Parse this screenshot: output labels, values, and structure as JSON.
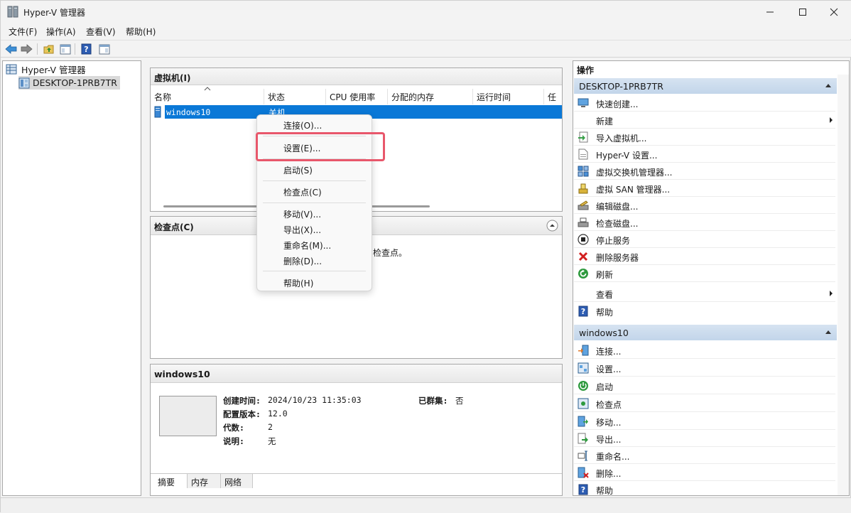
{
  "window": {
    "title": "Hyper-V 管理器"
  },
  "menubar": {
    "items": [
      "文件(F)",
      "操作(A)",
      "查看(V)",
      "帮助(H)"
    ]
  },
  "tree": {
    "root": "Hyper-V 管理器",
    "child": "DESKTOP-1PRB7TR"
  },
  "vm_panel": {
    "title": "虚拟机(I)",
    "columns": [
      "名称",
      "状态",
      "CPU 使用率",
      "分配的内存",
      "运行时间",
      "任务"
    ],
    "rows": [
      {
        "name": "windows10",
        "state": "关机"
      }
    ]
  },
  "context_menu": {
    "items": [
      "连接(O)...",
      "设置(E)...",
      "启动(S)",
      "检查点(C)",
      "移动(V)...",
      "导出(X)...",
      "重命名(M)...",
      "删除(D)...",
      "帮助(H)"
    ]
  },
  "checkpoint_panel": {
    "title": "检查点(C)",
    "message_fragment": "检查点。"
  },
  "detail_panel": {
    "title": "windows10",
    "created_label": "创建时间:",
    "created_value": "2024/10/23 11:35:03",
    "clustered_label": "已群集:",
    "clustered_value": "否",
    "config_label": "配置版本:",
    "config_value": "12.0",
    "generation_label": "代数:",
    "generation_value": "2",
    "notes_label": "说明:",
    "notes_value": "无",
    "tabs": [
      "摘要",
      "内存",
      "网络"
    ]
  },
  "actions": {
    "title": "操作",
    "server_section": "DESKTOP-1PRB7TR",
    "server_items": [
      {
        "label": "快速创建...",
        "icon": "quick-create-icon"
      },
      {
        "label": "新建",
        "icon": "none",
        "submenu": true
      },
      {
        "label": "导入虚拟机...",
        "icon": "import-vm-icon"
      },
      {
        "label": "Hyper-V 设置...",
        "icon": "hyperv-settings-icon"
      },
      {
        "label": "虚拟交换机管理器...",
        "icon": "virtual-switch-icon"
      },
      {
        "label": "虚拟 SAN 管理器...",
        "icon": "virtual-san-icon"
      },
      {
        "label": "编辑磁盘...",
        "icon": "edit-disk-icon"
      },
      {
        "label": "检查磁盘...",
        "icon": "inspect-disk-icon"
      },
      {
        "label": "停止服务",
        "icon": "stop-service-icon"
      },
      {
        "label": "删除服务器",
        "icon": "remove-server-icon"
      },
      {
        "label": "刷新",
        "icon": "refresh-icon"
      },
      {
        "label": "查看",
        "icon": "none",
        "submenu": true
      },
      {
        "label": "帮助",
        "icon": "help-icon"
      }
    ],
    "vm_section": "windows10",
    "vm_items": [
      {
        "label": "连接...",
        "icon": "connect-icon"
      },
      {
        "label": "设置...",
        "icon": "settings-icon"
      },
      {
        "label": "启动",
        "icon": "start-icon"
      },
      {
        "label": "检查点",
        "icon": "checkpoint-icon"
      },
      {
        "label": "移动...",
        "icon": "move-icon"
      },
      {
        "label": "导出...",
        "icon": "export-icon"
      },
      {
        "label": "重命名...",
        "icon": "rename-icon"
      },
      {
        "label": "删除...",
        "icon": "delete-icon"
      },
      {
        "label": "帮助",
        "icon": "help-icon"
      }
    ]
  },
  "colors": {
    "selection": "#0a78d7",
    "section_header": "#c9daee",
    "highlight_box": "#e8576b"
  }
}
